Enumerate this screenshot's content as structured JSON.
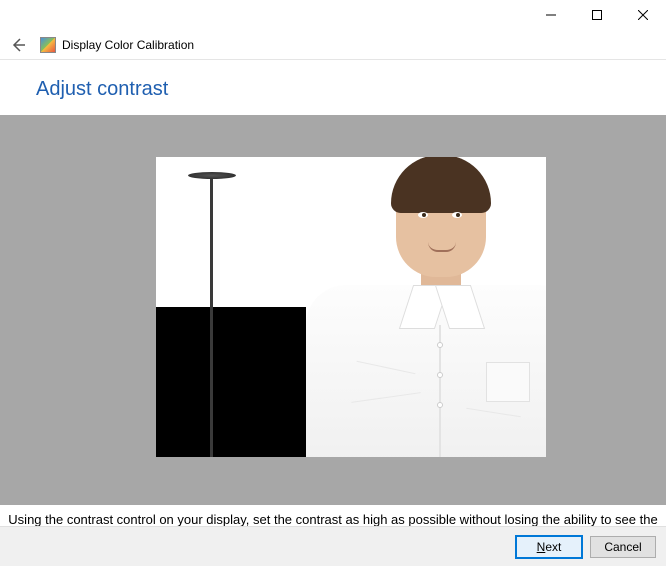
{
  "window": {
    "title": "Display Color Calibration"
  },
  "page": {
    "heading": "Adjust contrast",
    "instruction": "Using the contrast control on your display, set the contrast as high as possible without losing the ability to see the wrinkles and buttons on the shirt."
  },
  "buttons": {
    "next": "Next",
    "cancel": "Cancel"
  }
}
